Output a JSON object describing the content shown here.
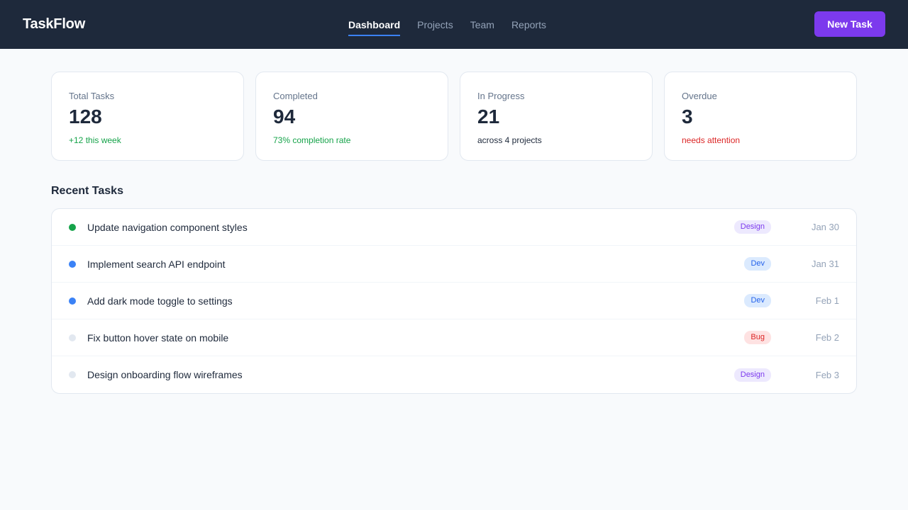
{
  "app": {
    "name": "TaskFlow"
  },
  "nav": {
    "items": [
      {
        "label": "Dashboard",
        "active": true
      },
      {
        "label": "Projects",
        "active": false
      },
      {
        "label": "Team",
        "active": false
      },
      {
        "label": "Reports",
        "active": false
      }
    ],
    "accent": "#3b82f6"
  },
  "actions": {
    "new_task_label": "New Task",
    "color": "#7c3aed"
  },
  "stats": [
    {
      "label": "Total Tasks",
      "value": "128",
      "sub": "+12 this week",
      "sub_color": "#16a34a"
    },
    {
      "label": "Completed",
      "value": "94",
      "sub": "73% completion rate",
      "sub_color": "#16a34a"
    },
    {
      "label": "In Progress",
      "value": "21",
      "sub": "across 4 projects",
      "sub_color": "#1e293b"
    },
    {
      "label": "Overdue",
      "value": "3",
      "sub": "needs attention",
      "sub_color": "#dc2626"
    }
  ],
  "recent": {
    "title": "Recent Tasks",
    "tasks": [
      {
        "title": "Update navigation component styles",
        "tag": "Design",
        "date": "Jan 30",
        "status_color": "#16a34a"
      },
      {
        "title": "Implement search API endpoint",
        "tag": "Dev",
        "date": "Jan 31",
        "status_color": "#3b82f6"
      },
      {
        "title": "Add dark mode toggle to settings",
        "tag": "Dev",
        "date": "Feb 1",
        "status_color": "#3b82f6"
      },
      {
        "title": "Fix button hover state on mobile",
        "tag": "Bug",
        "date": "Feb 2",
        "status_color": "#e2e8f0"
      },
      {
        "title": "Design onboarding flow wireframes",
        "tag": "Design",
        "date": "Feb 3",
        "status_color": "#e2e8f0"
      }
    ]
  },
  "tag_colors": {
    "Design": {
      "bg": "#ede9fe",
      "fg": "#7c3aed"
    },
    "Dev": {
      "bg": "#dbeafe",
      "fg": "#2563eb"
    },
    "Bug": {
      "bg": "#fee2e2",
      "fg": "#dc2626"
    }
  }
}
